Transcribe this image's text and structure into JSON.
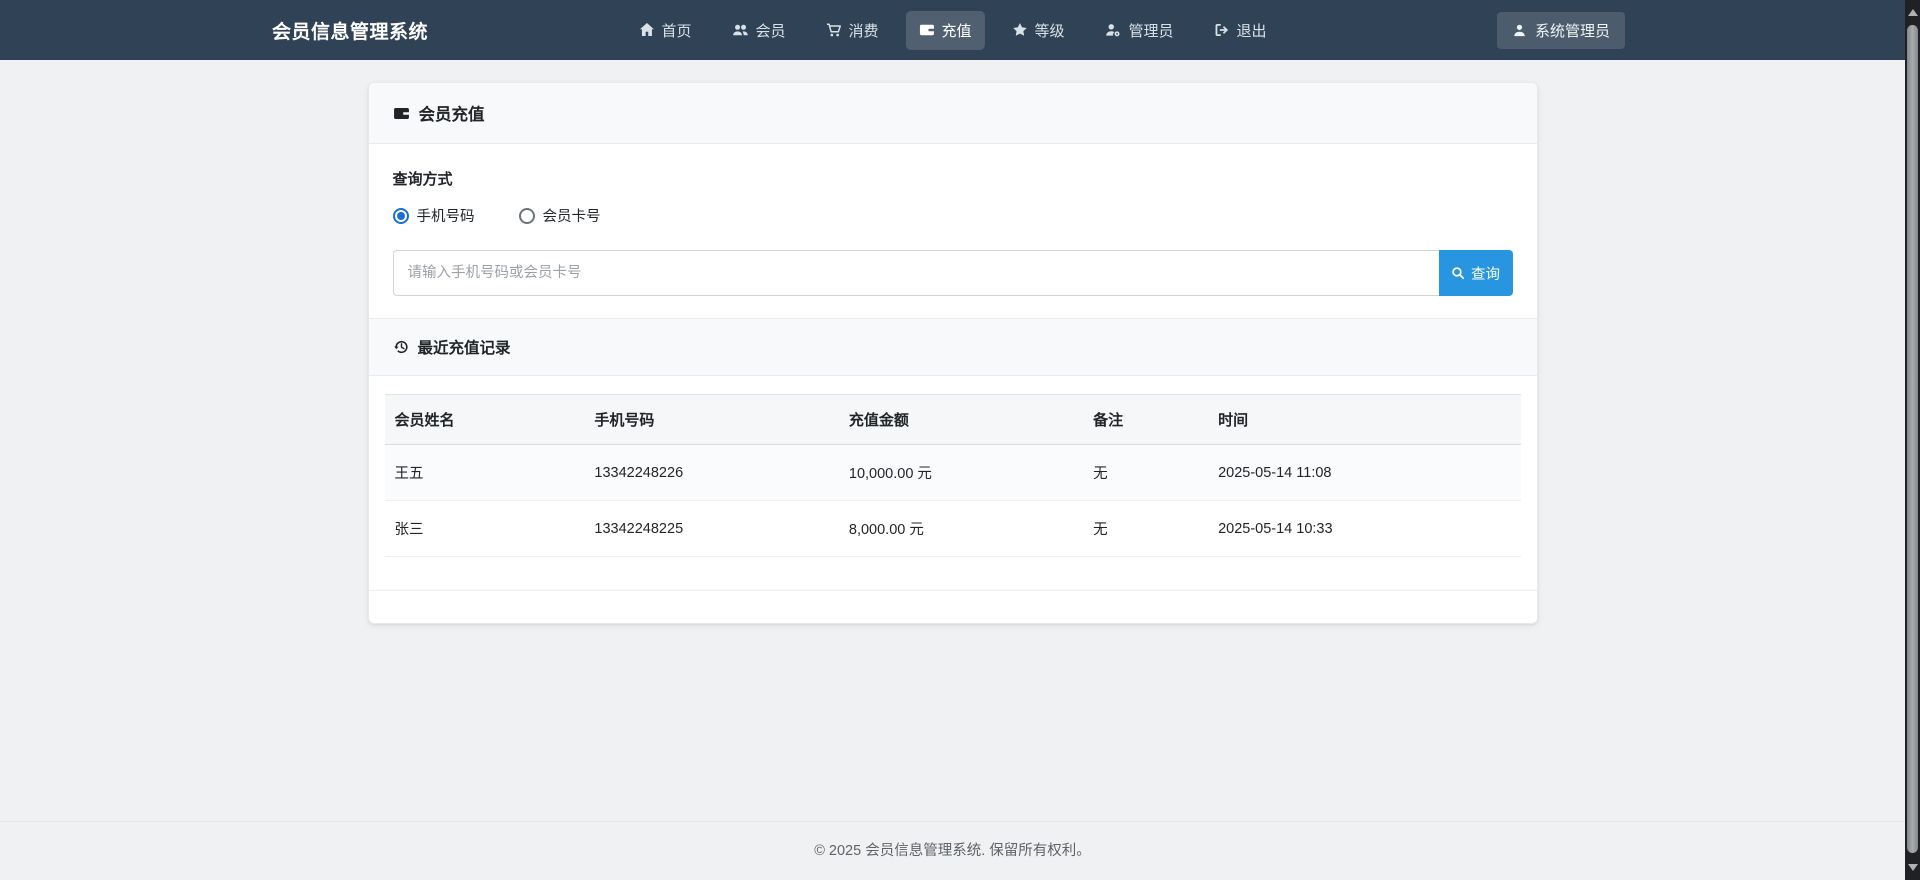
{
  "navbar": {
    "brand": "会员信息管理系统",
    "items": [
      {
        "label": "首页",
        "icon": "home-icon",
        "active": false
      },
      {
        "label": "会员",
        "icon": "users-icon",
        "active": false
      },
      {
        "label": "消费",
        "icon": "cart-icon",
        "active": false
      },
      {
        "label": "充值",
        "icon": "wallet-icon",
        "active": true
      },
      {
        "label": "等级",
        "icon": "star-icon",
        "active": false
      },
      {
        "label": "管理员",
        "icon": "admin-icon",
        "active": false
      },
      {
        "label": "退出",
        "icon": "logout-icon",
        "active": false
      }
    ],
    "user": {
      "label": "系统管理员",
      "icon": "user-icon"
    }
  },
  "recharge_card": {
    "header": "会员充值",
    "query_method_label": "查询方式",
    "radio_options": [
      {
        "label": "手机号码",
        "selected": true
      },
      {
        "label": "会员卡号",
        "selected": false
      }
    ],
    "search": {
      "placeholder": "请输入手机号码或会员卡号",
      "button_label": "查询"
    },
    "records_header": "最近充值记录",
    "table": {
      "columns": [
        "会员姓名",
        "手机号码",
        "充值金额",
        "备注",
        "时间"
      ],
      "rows": [
        [
          "王五",
          "13342248226",
          "10,000.00 元",
          "无",
          "2025-05-14 11:08"
        ],
        [
          "张三",
          "13342248225",
          "8,000.00 元",
          "无",
          "2025-05-14 10:33"
        ]
      ]
    }
  },
  "footer": {
    "copyright": "© 2025 会员信息管理系统. 保留所有权利。"
  },
  "colors": {
    "navbar_bg": "#2f4256",
    "primary": "#2795e0",
    "page_bg": "#eff1f3",
    "card_header_bg": "#f8f9fa",
    "radio_selected": "#1a6fd4"
  }
}
